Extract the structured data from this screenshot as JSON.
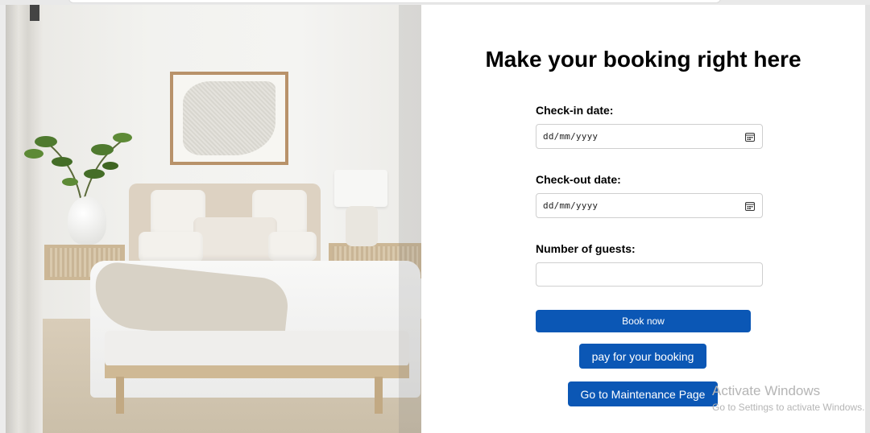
{
  "page": {
    "title": "Make your booking right here"
  },
  "form": {
    "checkin": {
      "label": "Check-in date:",
      "placeholder": "dd/mm/yyyy"
    },
    "checkout": {
      "label": "Check-out date:",
      "placeholder": "dd/mm/yyyy"
    },
    "guests": {
      "label": "Number of guests:",
      "value": ""
    },
    "book_label": "Book now",
    "pay_label": "pay for your booking",
    "maintenance_label": "Go to Maintenance Page"
  },
  "watermark": {
    "title": "Activate Windows",
    "subtitle": "Go to Settings to activate Windows."
  },
  "icons": {
    "date_field_icon": "calendar-icon"
  },
  "colors": {
    "primary_button": "#0b57b5",
    "background": "#ffffff"
  }
}
